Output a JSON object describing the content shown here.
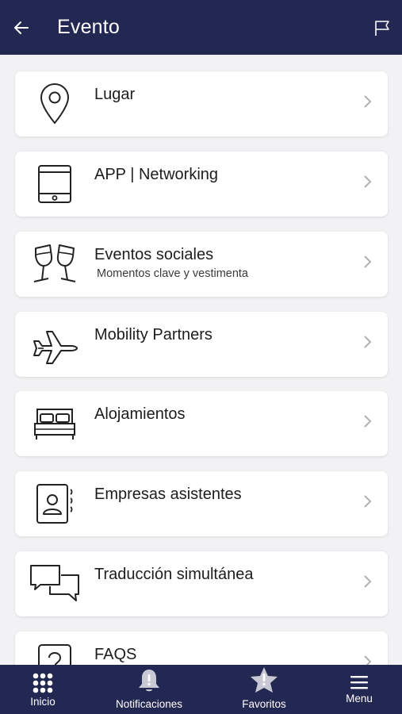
{
  "header": {
    "title": "Evento",
    "back_icon": "arrow-left-icon",
    "action_icon": "flag-icon"
  },
  "colors": {
    "primary": "#232852",
    "background": "#f2f2f4",
    "card": "#ffffff",
    "text": "#1d1d1f",
    "chevron": "#b0b0b6"
  },
  "items": [
    {
      "label": "Lugar",
      "subtitle": "",
      "icon": "map-pin-icon"
    },
    {
      "label": "APP | Networking",
      "subtitle": "",
      "icon": "tablet-icon"
    },
    {
      "label": "Eventos sociales",
      "subtitle": "Momentos clave y vestimenta",
      "icon": "wine-glasses-icon"
    },
    {
      "label": "Mobility Partners",
      "subtitle": "",
      "icon": "airplane-icon"
    },
    {
      "label": "Alojamientos",
      "subtitle": "",
      "icon": "bed-icon"
    },
    {
      "label": "Empresas asistentes",
      "subtitle": "",
      "icon": "contact-book-icon"
    },
    {
      "label": "Traducción simultánea",
      "subtitle": "",
      "icon": "chat-bubbles-icon"
    },
    {
      "label": "FAQS",
      "subtitle": "",
      "icon": "question-icon"
    }
  ],
  "tabbar": {
    "tabs": [
      {
        "label": "Inicio",
        "icon": "grid-icon"
      },
      {
        "label": "Notificaciones",
        "icon": "bell-icon"
      },
      {
        "label": "Favoritos",
        "icon": "star-icon"
      },
      {
        "label": "Menu",
        "icon": "hamburger-icon"
      }
    ]
  }
}
